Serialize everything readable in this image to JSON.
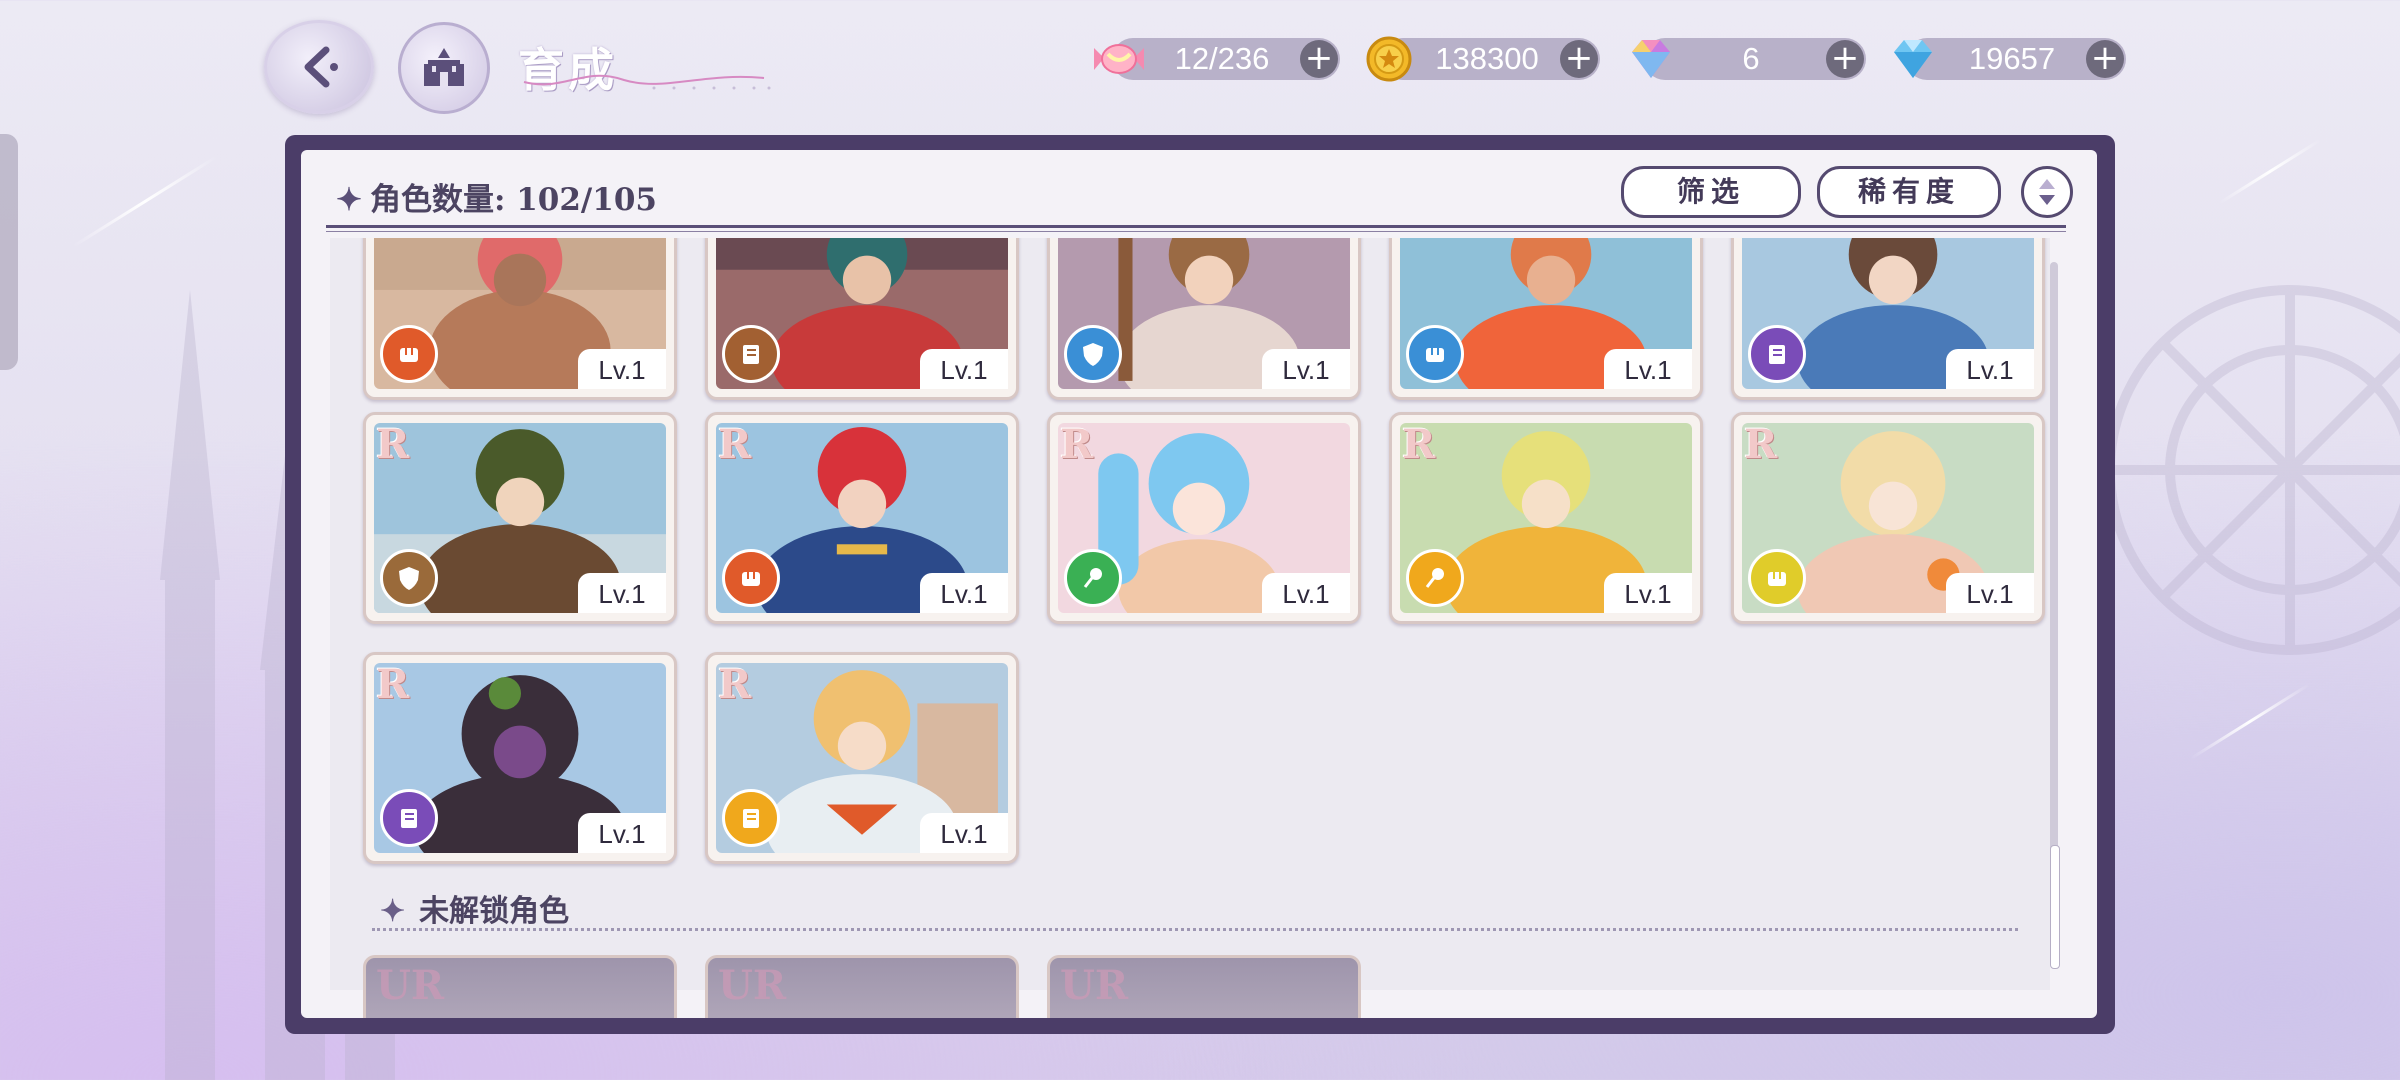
{
  "header": {
    "title": "育成",
    "resources": [
      {
        "icon": "candy-icon",
        "value": "12/236"
      },
      {
        "icon": "gold-coin-icon",
        "value": "138300"
      },
      {
        "icon": "rainbow-gem-icon",
        "value": "6"
      },
      {
        "icon": "blue-diamond-icon",
        "value": "19657"
      }
    ]
  },
  "roster": {
    "count_label": "角色数量: 102/105",
    "filter_label": "筛选",
    "rarity_label": "稀有度"
  },
  "cards": [
    {
      "rarity": "",
      "level": "Lv.1",
      "role": "fist",
      "role_color": "#e05a2a"
    },
    {
      "rarity": "",
      "level": "Lv.1",
      "role": "book",
      "role_color": "#a26032"
    },
    {
      "rarity": "",
      "level": "Lv.1",
      "role": "shield",
      "role_color": "#3a8fd6"
    },
    {
      "rarity": "",
      "level": "Lv.1",
      "role": "fist",
      "role_color": "#3a8fd6"
    },
    {
      "rarity": "",
      "level": "Lv.1",
      "role": "book",
      "role_color": "#7a4cb8"
    },
    {
      "rarity": "R",
      "level": "Lv.1",
      "role": "shield",
      "role_color": "#9a6a3a"
    },
    {
      "rarity": "R",
      "level": "Lv.1",
      "role": "fist",
      "role_color": "#e05a2a"
    },
    {
      "rarity": "R",
      "level": "Lv.1",
      "role": "wand",
      "role_color": "#3ab054"
    },
    {
      "rarity": "R",
      "level": "Lv.1",
      "role": "wand",
      "role_color": "#f0a81c"
    },
    {
      "rarity": "R",
      "level": "Lv.1",
      "role": "fist",
      "role_color": "#e0cc2a"
    },
    {
      "rarity": "R",
      "level": "Lv.1",
      "role": "book",
      "role_color": "#7a4cb8"
    },
    {
      "rarity": "R",
      "level": "Lv.1",
      "role": "book",
      "role_color": "#f0a81c"
    }
  ],
  "locked": {
    "title": "未解锁角色",
    "cards": [
      {
        "rarity": "UR"
      },
      {
        "rarity": "UR"
      },
      {
        "rarity": "UR"
      }
    ]
  },
  "colors": {
    "panel_frame": "#4b3d68",
    "panel_bg": "#f4f2f7",
    "resource_pill": "#b8b1c9"
  }
}
